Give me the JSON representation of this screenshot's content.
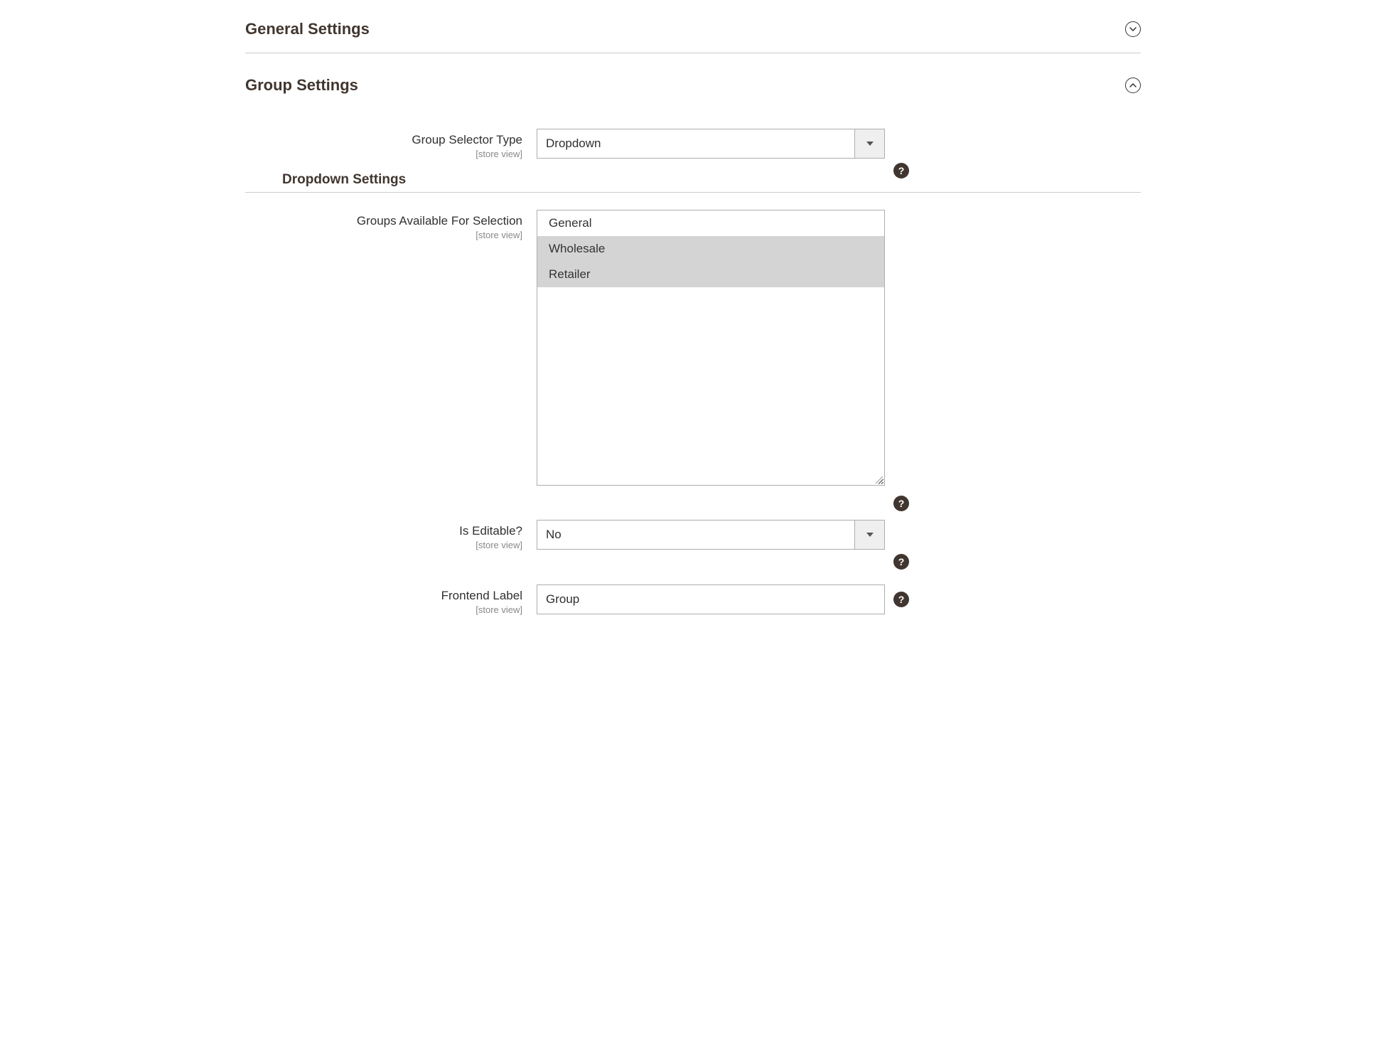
{
  "sections": {
    "general": {
      "title": "General Settings"
    },
    "group": {
      "title": "Group Settings"
    }
  },
  "scope_label": "[store view]",
  "subsection": {
    "title": "Dropdown Settings"
  },
  "fields": {
    "selector_type": {
      "label": "Group Selector Type",
      "value": "Dropdown"
    },
    "groups_available": {
      "label": "Groups Available For Selection",
      "options": [
        {
          "label": "General",
          "selected": false
        },
        {
          "label": "Wholesale",
          "selected": true
        },
        {
          "label": "Retailer",
          "selected": true
        }
      ]
    },
    "is_editable": {
      "label": "Is Editable?",
      "value": "No"
    },
    "frontend_label": {
      "label": "Frontend Label",
      "value": "Group"
    }
  }
}
